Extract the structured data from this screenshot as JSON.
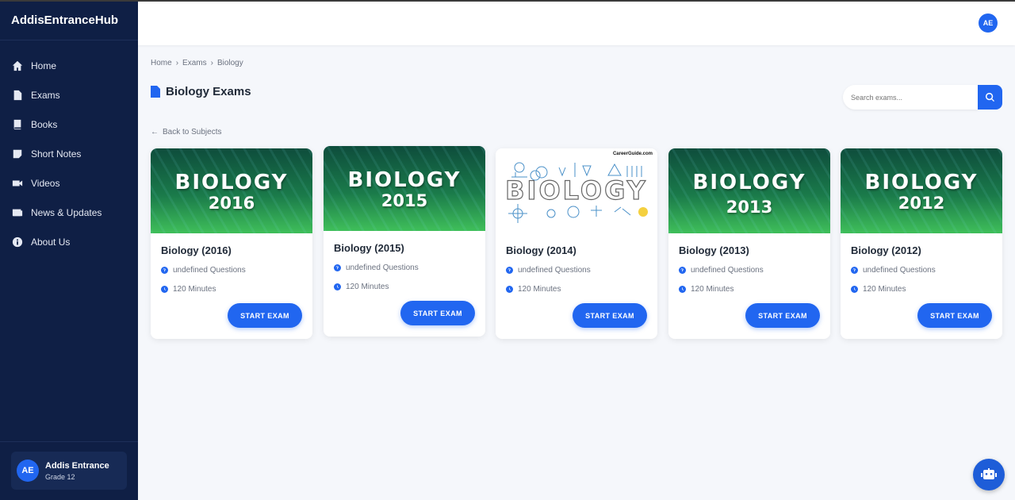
{
  "app": {
    "brand": "AddisEntranceHub"
  },
  "sidebar": {
    "items": [
      {
        "label": "Home",
        "icon": "home-icon"
      },
      {
        "label": "Exams",
        "icon": "file-icon"
      },
      {
        "label": "Books",
        "icon": "book-icon"
      },
      {
        "label": "Short Notes",
        "icon": "note-icon"
      },
      {
        "label": "Videos",
        "icon": "video-icon"
      },
      {
        "label": "News & Updates",
        "icon": "newspaper-icon"
      },
      {
        "label": "About Us",
        "icon": "info-icon"
      }
    ],
    "user": {
      "initials": "AE",
      "name": "Addis Entrance",
      "grade": "Grade 12"
    }
  },
  "header": {
    "avatar_initials": "AE"
  },
  "breadcrumb": {
    "home": "Home",
    "exams": "Exams",
    "current": "Biology"
  },
  "page": {
    "title": "Biology Exams",
    "back_label": "Back to Subjects",
    "search_placeholder": "Search exams..."
  },
  "cards": [
    {
      "title": "Biology (2016)",
      "banner_word": "BIOLOGY",
      "banner_year": "2016",
      "questions": "undefined Questions",
      "duration": "120 Minutes",
      "button": "START EXAM"
    },
    {
      "title": "Biology (2015)",
      "banner_word": "BIOLOGY",
      "banner_year": "2015",
      "questions": "undefined Questions",
      "duration": "120 Minutes",
      "button": "START EXAM"
    },
    {
      "title": "Biology (2014)",
      "banner_word": "BIOLOGY",
      "banner_credit": "CareerGuide.com",
      "questions": "undefined Questions",
      "duration": "120 Minutes",
      "button": "START EXAM"
    },
    {
      "title": "Biology (2013)",
      "banner_word": "BIOLOGY",
      "banner_year": "2013",
      "questions": "undefined Questions",
      "duration": "120 Minutes",
      "button": "START EXAM"
    },
    {
      "title": "Biology (2012)",
      "banner_word": "BIOLOGY",
      "banner_year": "2012",
      "questions": "undefined Questions",
      "duration": "120 Minutes",
      "button": "START EXAM"
    }
  ],
  "colors": {
    "sidebar_bg": "#0f1f45",
    "accent": "#2166f0",
    "page_bg": "#f5f7fb"
  }
}
